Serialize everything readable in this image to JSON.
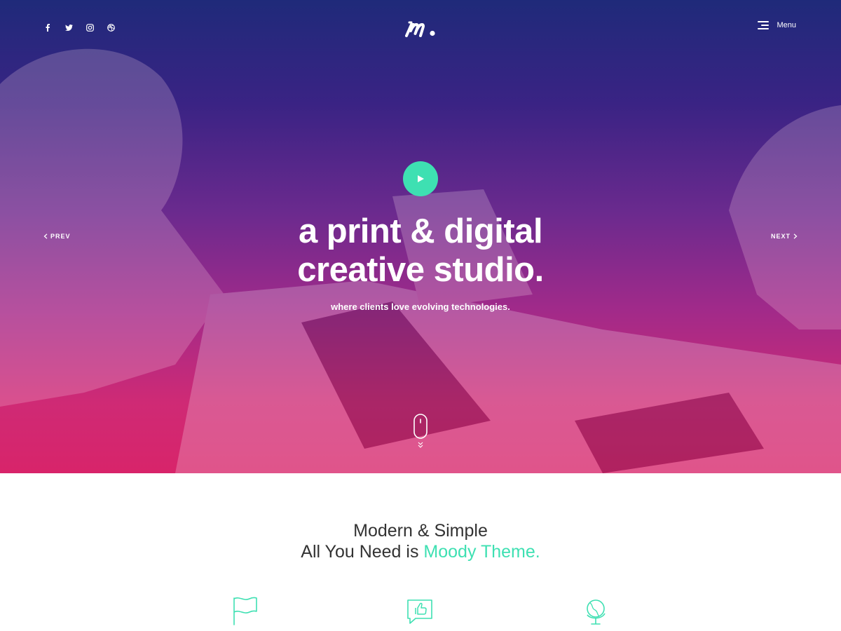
{
  "header": {
    "social_icons": [
      "facebook-icon",
      "twitter-icon",
      "instagram-icon",
      "dribbble-icon"
    ],
    "logo_icon": "moody-logo",
    "menu_label": "Menu"
  },
  "hero": {
    "title_line1": "a print & digital",
    "title_line2": "creative studio.",
    "subtitle": "where clients love evolving technologies.",
    "prev_label": "PREV",
    "next_label": "NEXT",
    "play_icon": "play-icon",
    "scroll_icon": "mouse-scroll-icon"
  },
  "intro": {
    "line1": "Modern & Simple",
    "line2_prefix": "All You Need is",
    "line2_accent": "Moody Theme."
  },
  "features": {
    "icons": [
      "flag-icon",
      "thumbs-up-chat-icon",
      "globe-icon"
    ]
  },
  "colors": {
    "accent": "#3ee0b2",
    "gradient_top": "#1f2a7a",
    "gradient_bottom": "#d8246a",
    "text_dark": "#333333"
  }
}
